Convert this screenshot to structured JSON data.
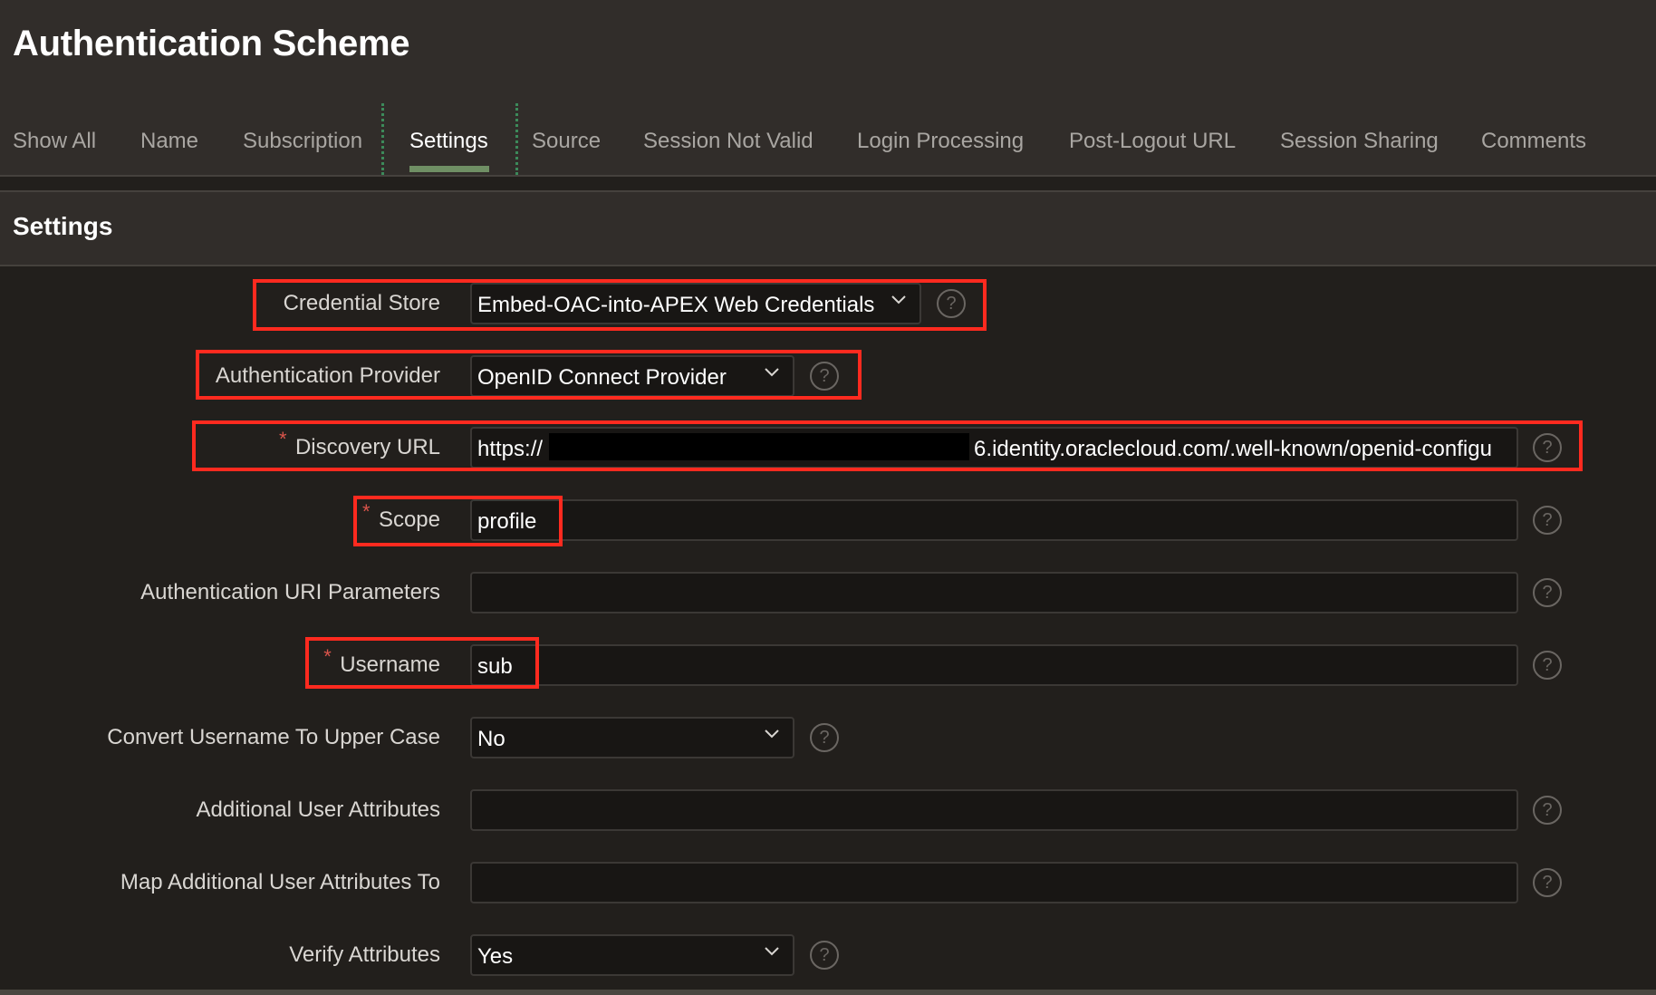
{
  "page": {
    "title": "Authentication Scheme"
  },
  "tabs": [
    {
      "label": "Show All",
      "active": false
    },
    {
      "label": "Name",
      "active": false
    },
    {
      "label": "Subscription",
      "active": false
    },
    {
      "label": "Settings",
      "active": true
    },
    {
      "label": "Source",
      "active": false
    },
    {
      "label": "Session Not Valid",
      "active": false
    },
    {
      "label": "Login Processing",
      "active": false
    },
    {
      "label": "Post-Logout URL",
      "active": false
    },
    {
      "label": "Session Sharing",
      "active": false
    },
    {
      "label": "Comments",
      "active": false
    }
  ],
  "section": {
    "title": "Settings"
  },
  "fields": {
    "credential_store": {
      "label": "Credential Store",
      "value": "Embed-OAC-into-APEX Web Credentials",
      "type": "select",
      "required": false,
      "highlighted": true
    },
    "authentication_provider": {
      "label": "Authentication Provider",
      "value": "OpenID Connect Provider",
      "type": "select",
      "required": false,
      "highlighted": true
    },
    "discovery_url": {
      "label": "Discovery URL",
      "value_prefix": "https://",
      "value_suffix": "6.identity.oraclecloud.com/.well-known/openid-configu",
      "redacted": true,
      "type": "text",
      "required": true,
      "highlighted": true
    },
    "scope": {
      "label": "Scope",
      "value": "profile",
      "type": "text",
      "required": true,
      "highlighted": true
    },
    "authentication_uri_parameters": {
      "label": "Authentication URI Parameters",
      "value": "",
      "type": "text",
      "required": false
    },
    "username": {
      "label": "Username",
      "value": "sub",
      "type": "text",
      "required": true,
      "highlighted": true
    },
    "convert_username_upper": {
      "label": "Convert Username To Upper Case",
      "value": "No",
      "type": "select",
      "required": false
    },
    "additional_user_attributes": {
      "label": "Additional User Attributes",
      "value": "",
      "type": "text",
      "required": false
    },
    "map_additional_user_attributes": {
      "label": "Map Additional User Attributes To",
      "value": "",
      "type": "text",
      "required": false
    },
    "verify_attributes": {
      "label": "Verify Attributes",
      "value": "Yes",
      "type": "select",
      "required": false
    }
  },
  "icons": {
    "help": "?",
    "required": "*"
  },
  "colors": {
    "accent_tab": "#6f8f64",
    "highlight": "#ff2a1f",
    "required": "#d9544b"
  }
}
